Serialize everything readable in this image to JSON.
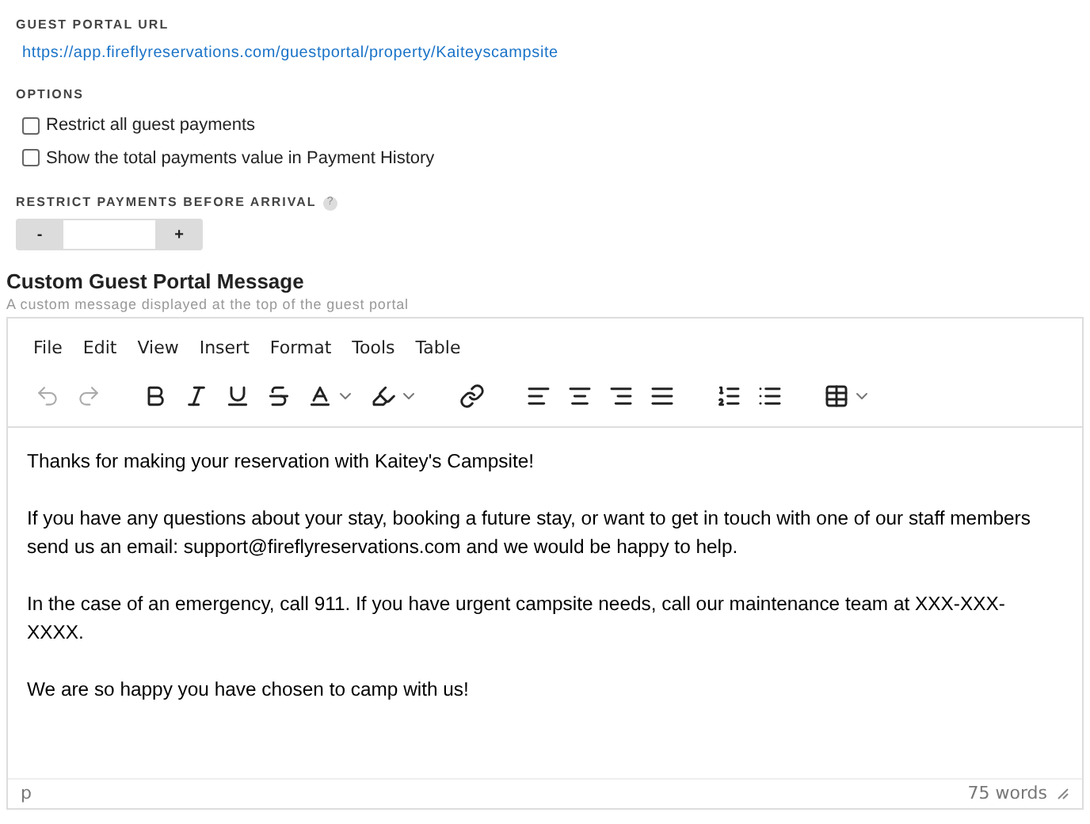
{
  "guest_portal_url": {
    "label": "GUEST PORTAL URL",
    "url": "https://app.fireflyreservations.com/guestportal/property/Kaiteyscampsite"
  },
  "options": {
    "label": "OPTIONS",
    "items": [
      {
        "label": "Restrict all guest payments",
        "checked": false
      },
      {
        "label": "Show the total payments value in Payment History",
        "checked": false
      }
    ]
  },
  "restrict_before_arrival": {
    "label": "RESTRICT PAYMENTS BEFORE ARRIVAL",
    "help": "?",
    "minus": "-",
    "plus": "+"
  },
  "message": {
    "title": "Custom Guest Portal Message",
    "description": "A custom message displayed at the top of the guest portal",
    "menu": [
      "File",
      "Edit",
      "View",
      "Insert",
      "Format",
      "Tools",
      "Table"
    ],
    "toolbar": [
      {
        "kind": "undo",
        "disabled": true
      },
      {
        "kind": "redo",
        "disabled": true
      },
      {
        "kind": "bold",
        "disabled": false
      },
      {
        "kind": "italic",
        "disabled": false
      },
      {
        "kind": "underline",
        "disabled": false
      },
      {
        "kind": "strike",
        "disabled": false
      },
      {
        "kind": "textcolor",
        "disabled": false
      },
      {
        "kind": "highlight",
        "disabled": false
      },
      {
        "kind": "link",
        "disabled": false
      },
      {
        "kind": "alignleft",
        "disabled": false
      },
      {
        "kind": "aligncenter",
        "disabled": false
      },
      {
        "kind": "alignright",
        "disabled": false
      },
      {
        "kind": "justify",
        "disabled": false
      },
      {
        "kind": "numlist",
        "disabled": false
      },
      {
        "kind": "bullist",
        "disabled": false
      },
      {
        "kind": "table",
        "disabled": false
      }
    ],
    "paragraphs": [
      "Thanks for making your reservation with Kaitey's Campsite!",
      "If you have any questions about your stay, booking a future stay, or want to get in touch with one of our staff members send us an email: support@fireflyreservations.com and we would be happy to help.",
      "In the case of an emergency, call 911. If you have urgent campsite needs, call our maintenance team at XXX-XXX-XXXX.",
      "We are so happy you have chosen to camp with us!"
    ],
    "path": "p",
    "word_count": "75 words"
  }
}
